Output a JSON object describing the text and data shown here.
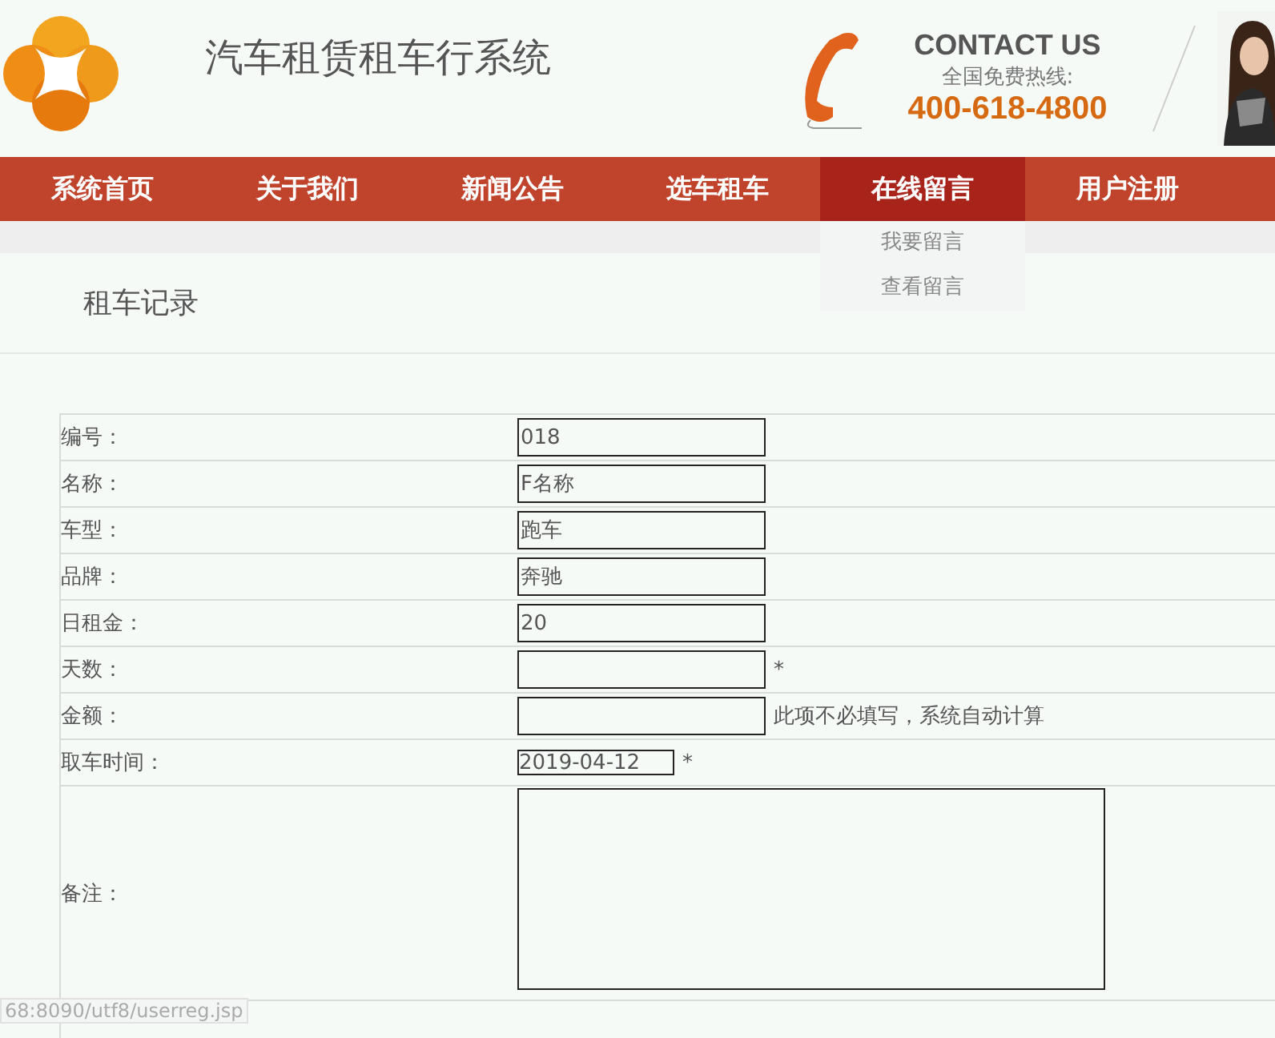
{
  "header": {
    "title": "汽车租赁租车行系统",
    "contact_heading": "CONTACT US",
    "hotline_label": "全国免费热线:",
    "hotline_number": "400-618-4800"
  },
  "nav": [
    {
      "label": "系统首页",
      "selected": false
    },
    {
      "label": "关于我们",
      "selected": false
    },
    {
      "label": "新闻公告",
      "selected": false
    },
    {
      "label": "选车租车",
      "selected": false
    },
    {
      "label": "在线留言",
      "selected": true,
      "dropdown": [
        "我要留言",
        "查看留言"
      ]
    },
    {
      "label": "用户注册",
      "selected": false
    }
  ],
  "page_title": "租车记录",
  "form": [
    {
      "label": "编号：",
      "kind": "input",
      "value": "018"
    },
    {
      "label": "名称：",
      "kind": "input",
      "value": "F名称"
    },
    {
      "label": "车型：",
      "kind": "input",
      "value": "跑车"
    },
    {
      "label": "品牌：",
      "kind": "input",
      "value": "奔驰"
    },
    {
      "label": "日租金：",
      "kind": "input",
      "value": "20"
    },
    {
      "label": "天数：",
      "kind": "input",
      "note": "*"
    },
    {
      "label": "金额：",
      "kind": "input",
      "note": "此项不必填写，系统自动计算"
    },
    {
      "label": "取车时间：",
      "kind": "date",
      "value": "2019-04-12",
      "note": "*"
    },
    {
      "label": "备注：",
      "kind": "textarea"
    }
  ],
  "status_bar": "68:8090/utf8/userreg.jsp"
}
